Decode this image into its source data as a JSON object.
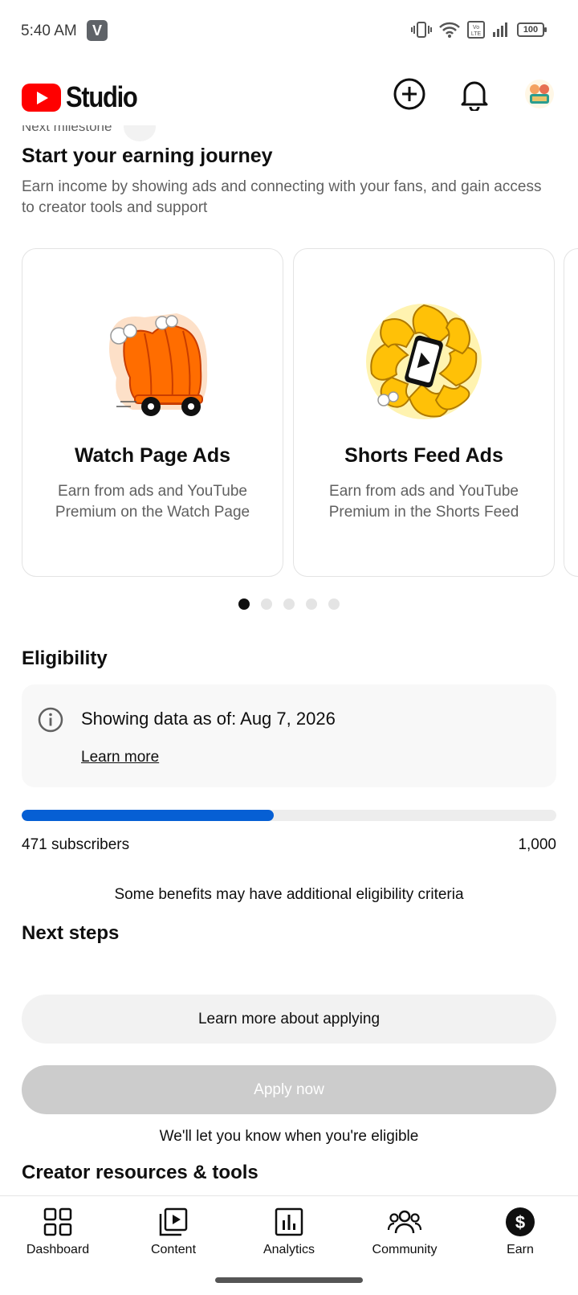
{
  "status_bar": {
    "time": "5:40 AM",
    "app_badge": "V",
    "battery": "100"
  },
  "header": {
    "logo_text": "Studio"
  },
  "earning": {
    "milestone_label": "Next milestone",
    "title": "Start your earning journey",
    "description": "Earn income by showing ads and connecting with your fans, and gain access to creator tools and support"
  },
  "cards": [
    {
      "title": "Watch Page Ads",
      "description": "Earn from ads and YouTube Premium on the Watch Page"
    },
    {
      "title": "Shorts Feed Ads",
      "description": "Earn from ads and YouTube Premium in the Shorts Feed"
    }
  ],
  "carousel": {
    "page_count": 5,
    "active_index": 0
  },
  "eligibility": {
    "title": "Eligibility",
    "data_as_of": "Showing data as of: Aug 7, 2026",
    "learn_more": "Learn more",
    "subscribers_label": "471 subscribers",
    "goal_label": "1,000",
    "progress_fraction": 0.471,
    "note": "Some benefits may have additional eligibility criteria"
  },
  "next_steps": {
    "title": "Next steps",
    "learn_more_button": "Learn more about applying",
    "apply_button": "Apply now",
    "eligible_note": "We'll let you know when you're eligible"
  },
  "resources": {
    "title": "Creator resources & tools"
  },
  "bottom_nav": [
    {
      "label": "Dashboard",
      "icon": "dashboard-icon"
    },
    {
      "label": "Content",
      "icon": "content-icon"
    },
    {
      "label": "Analytics",
      "icon": "analytics-icon"
    },
    {
      "label": "Community",
      "icon": "community-icon"
    },
    {
      "label": "Earn",
      "icon": "earn-icon"
    }
  ],
  "colors": {
    "brand_red": "#ff0000",
    "progress_blue": "#065fd4",
    "disabled_button": "#cccccc"
  }
}
